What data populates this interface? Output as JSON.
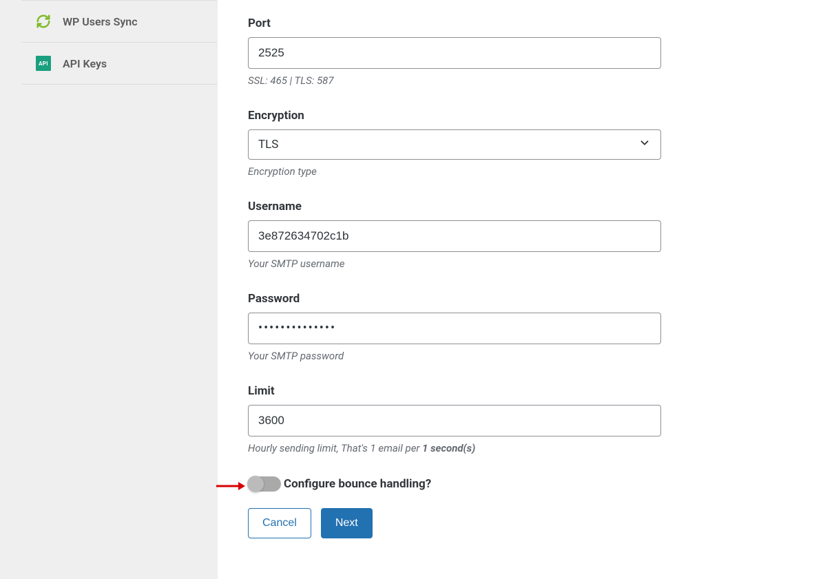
{
  "sidebar": {
    "items": [
      {
        "label": "WP Users Sync",
        "icon": "refresh-icon"
      },
      {
        "label": "API Keys",
        "icon": "api-icon",
        "iconText": "API"
      }
    ]
  },
  "form": {
    "port": {
      "label": "Port",
      "value": "2525",
      "help": "SSL: 465 | TLS: 587"
    },
    "encryption": {
      "label": "Encryption",
      "value": "TLS",
      "help": "Encryption type"
    },
    "username": {
      "label": "Username",
      "value": "3e872634702c1b",
      "help": "Your SMTP username"
    },
    "password": {
      "label": "Password",
      "value": "••••••••••••••",
      "help": "Your SMTP password"
    },
    "limit": {
      "label": "Limit",
      "value": "3600",
      "helpPrefix": "Hourly sending limit, That's 1 email per ",
      "helpBold": "1 second(s)"
    },
    "bounce": {
      "label": "Configure bounce handling?"
    },
    "buttons": {
      "cancel": "Cancel",
      "next": "Next"
    }
  }
}
